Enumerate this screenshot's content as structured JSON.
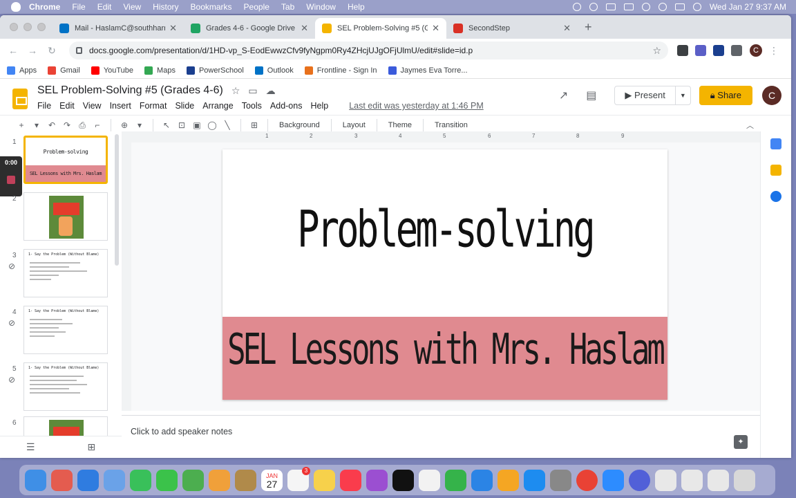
{
  "menubar": {
    "app": "Chrome",
    "items": [
      "File",
      "Edit",
      "View",
      "History",
      "Bookmarks",
      "People",
      "Tab",
      "Window",
      "Help"
    ],
    "clock": "Wed Jan 27  9:37 AM"
  },
  "tabs": [
    {
      "title": "Mail - HaslamC@southharrison",
      "color": "#0072c6"
    },
    {
      "title": "Grades 4-6 - Google Drive",
      "color": "#1fa463"
    },
    {
      "title": "SEL Problem-Solving #5 (Grad",
      "color": "#f4b400"
    },
    {
      "title": "SecondStep",
      "color": "#d93025"
    }
  ],
  "address": {
    "url": "docs.google.com/presentation/d/1HD-vp_S-EodEwwzCfv9fyNgpm0Ry4ZHcjUJgOFjUlmU/edit#slide=id.p"
  },
  "profile_initial": "C",
  "bookmarks": [
    {
      "label": "Apps",
      "color": "#4285f4"
    },
    {
      "label": "Gmail",
      "color": "#ea4335"
    },
    {
      "label": "YouTube",
      "color": "#ff0000"
    },
    {
      "label": "Maps",
      "color": "#34a853"
    },
    {
      "label": "PowerSchool",
      "color": "#1b3f8f"
    },
    {
      "label": "Outlook",
      "color": "#0072c6"
    },
    {
      "label": "Frontline - Sign In",
      "color": "#e8711c"
    },
    {
      "label": "Jaymes Eva Torre...",
      "color": "#3b5bdb"
    }
  ],
  "doc": {
    "title": "SEL Problem-Solving #5 (Grades 4-6)",
    "menu": [
      "File",
      "Edit",
      "View",
      "Insert",
      "Format",
      "Slide",
      "Arrange",
      "Tools",
      "Add-ons",
      "Help"
    ],
    "last_edit": "Last edit was yesterday at 1:46 PM",
    "present_label": "Present",
    "share_label": "Share",
    "avatar_initial": "C"
  },
  "edit_toolbar": {
    "background": "Background",
    "layout": "Layout",
    "theme": "Theme",
    "transition": "Transition"
  },
  "ruler": {
    "marks": [
      "1",
      "2",
      "3",
      "4",
      "5",
      "6",
      "7",
      "8",
      "9"
    ]
  },
  "recording": {
    "time": "0:00"
  },
  "thumbnails": [
    {
      "num": "1",
      "title": "Problem-solving",
      "band": "SEL Lessons with Mrs. Haslam"
    },
    {
      "num": "2",
      "poster_title": "Problem-Solving Steps"
    },
    {
      "num": "3",
      "heading": "1- Say the Problem (Without Blame)"
    },
    {
      "num": "4",
      "heading": "1- Say the Problem (Without Blame)"
    },
    {
      "num": "5",
      "heading": "1- Say the Problem (Without Blame)"
    },
    {
      "num": "6",
      "poster_title": "Problem-Solving Steps"
    }
  ],
  "slide": {
    "title": "Problem-solving",
    "subtitle": "SEL Lessons with Mrs. Haslam",
    "band_color": "#e08a90"
  },
  "notes": {
    "placeholder": "Click to add speaker notes"
  },
  "dock": {
    "calendar_month": "JAN",
    "calendar_day": "27",
    "reminders_badge": "3"
  }
}
